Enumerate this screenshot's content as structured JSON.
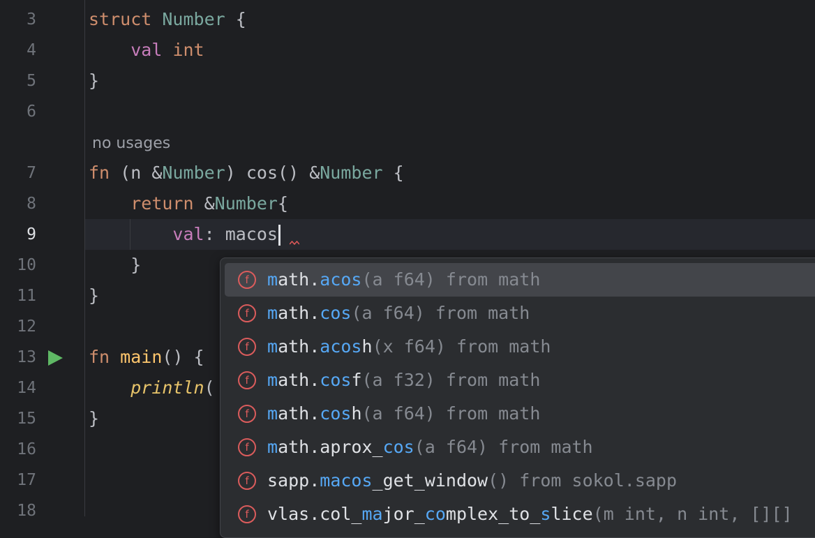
{
  "gutter": {
    "lines": [
      {
        "n": "3"
      },
      {
        "n": "4"
      },
      {
        "n": "5"
      },
      {
        "n": "6"
      },
      {
        "n": ""
      },
      {
        "n": "7"
      },
      {
        "n": "8"
      },
      {
        "n": "9"
      },
      {
        "n": "10"
      },
      {
        "n": "11"
      },
      {
        "n": "12"
      },
      {
        "n": "13"
      },
      {
        "n": "14"
      },
      {
        "n": "15"
      },
      {
        "n": "16"
      },
      {
        "n": "17"
      },
      {
        "n": "18"
      }
    ]
  },
  "editor": {
    "inlay_hint": "no usages",
    "code": {
      "l3_kw": "struct",
      "l3_type": "Number",
      "l3_brace": "{",
      "l4_kw": "val",
      "l4_type": "int",
      "l5": "}",
      "l7_fn": "fn",
      "l7_open": "(",
      "l7_n": "n",
      "l7_amp": "&",
      "l7_type": "Number",
      "l7_close": ")",
      "l7_method": "cos",
      "l7_parens": "()",
      "l7_amp2": "&",
      "l7_type2": "Number",
      "l7_brace": "{",
      "l8_ret": "return",
      "l8_amp": "&",
      "l8_type": "Number",
      "l8_brace": "{",
      "l9_field": "val",
      "l9_colon": ":",
      "l9_value": "macos",
      "l10": "}",
      "l11": "}",
      "l13_fn": "fn",
      "l13_main": "main",
      "l13_rest": "() {",
      "l14_call": "println",
      "l14_paren": "(",
      "l15": "}"
    }
  },
  "completion": {
    "items": [
      {
        "icon": "f",
        "pre": "m",
        "mid": "ath.",
        "match": "acos",
        "sig": "(a f64)",
        "from": " from math"
      },
      {
        "icon": "f",
        "pre": "m",
        "mid": "ath.",
        "match": "cos",
        "sig": "(a f64)",
        "from": " from math"
      },
      {
        "icon": "f",
        "pre": "m",
        "mid": "ath.",
        "match": "acos",
        "tail": "h",
        "sig": "(x f64)",
        "from": " from math"
      },
      {
        "icon": "f",
        "pre": "m",
        "mid": "ath.",
        "match": "cos",
        "tail": "f",
        "sig": "(a f32)",
        "from": " from math"
      },
      {
        "icon": "f",
        "pre": "m",
        "mid": "ath.",
        "match": "cos",
        "tail": "h",
        "sig": "(a f64)",
        "from": " from math"
      },
      {
        "icon": "f",
        "pre": "m",
        "mid": "ath.aprox_",
        "match": "cos",
        "sig": "(a f64)",
        "from": " from math"
      },
      {
        "icon": "f",
        "pre": "sapp.",
        "match": "macos",
        "tail": "_get_window",
        "sig": "()",
        "from": " from sokol.sapp"
      },
      {
        "icon": "f",
        "pre": "vlas.col_",
        "match": "ma",
        "tail": "jor_",
        "match2": "co",
        "tail2": "mplex_to_",
        "match3": "s",
        "tail3": "lice",
        "sig": "(m int, n int, [][]",
        "from": ""
      }
    ]
  }
}
